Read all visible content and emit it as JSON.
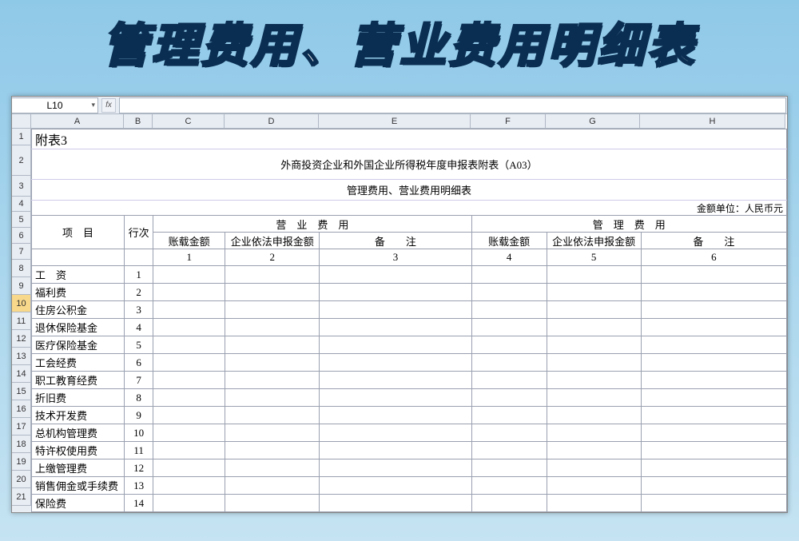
{
  "banner": {
    "text": "管理费用、营业费用明细表"
  },
  "formula_bar": {
    "cell_ref": "L10",
    "fx_label": "fx"
  },
  "columns": [
    "A",
    "B",
    "C",
    "D",
    "E",
    "F",
    "G",
    "H"
  ],
  "row_numbers": [
    1,
    2,
    3,
    4,
    5,
    6,
    7,
    8,
    9,
    10,
    11,
    12,
    13,
    14,
    15,
    16,
    17,
    18,
    19,
    20,
    21
  ],
  "selected_row": 10,
  "sheet": {
    "attachment_label": "附表3",
    "title1": "外商投资企业和外国企业所得税年度申报表附表（A03）",
    "title2": "管理费用、营业费用明细表",
    "unit_label": "金额单位：人民币元",
    "header": {
      "item": "项　目",
      "row_no": "行次",
      "group1": "营　业　费　用",
      "group2": "管　理　费　用",
      "col1": "账载金额",
      "col2": "企业依法申报金额",
      "col3": "备　　注",
      "col4": "账载金额",
      "col5": "企业依法申报金额",
      "col6": "备　　注",
      "num1": "1",
      "num2": "2",
      "num3": "3",
      "num4": "4",
      "num5": "5",
      "num6": "6"
    },
    "rows": [
      {
        "label": "工　资",
        "n": "1"
      },
      {
        "label": "福利费",
        "n": "2"
      },
      {
        "label": "住房公积金",
        "n": "3"
      },
      {
        "label": "退休保险基金",
        "n": "4"
      },
      {
        "label": "医疗保险基金",
        "n": "5"
      },
      {
        "label": "工会经费",
        "n": "6"
      },
      {
        "label": "职工教育经费",
        "n": "7"
      },
      {
        "label": "折旧费",
        "n": "8"
      },
      {
        "label": "技术开发费",
        "n": "9"
      },
      {
        "label": "总机构管理费",
        "n": "10"
      },
      {
        "label": "特许权使用费",
        "n": "11"
      },
      {
        "label": "上缴管理费",
        "n": "12"
      },
      {
        "label": "销售佣金或手续费",
        "n": "13"
      },
      {
        "label": "保险费",
        "n": "14"
      }
    ]
  },
  "chart_data": {
    "type": "table",
    "title": "管理费用、营业费用明细表",
    "columns": [
      "项目",
      "行次",
      "营业费用-账载金额",
      "营业费用-企业依法申报金额",
      "营业费用-备注",
      "管理费用-账载金额",
      "管理费用-企业依法申报金额",
      "管理费用-备注"
    ],
    "rows": [
      [
        "工资",
        1,
        null,
        null,
        null,
        null,
        null,
        null
      ],
      [
        "福利费",
        2,
        null,
        null,
        null,
        null,
        null,
        null
      ],
      [
        "住房公积金",
        3,
        null,
        null,
        null,
        null,
        null,
        null
      ],
      [
        "退休保险基金",
        4,
        null,
        null,
        null,
        null,
        null,
        null
      ],
      [
        "医疗保险基金",
        5,
        null,
        null,
        null,
        null,
        null,
        null
      ],
      [
        "工会经费",
        6,
        null,
        null,
        null,
        null,
        null,
        null
      ],
      [
        "职工教育经费",
        7,
        null,
        null,
        null,
        null,
        null,
        null
      ],
      [
        "折旧费",
        8,
        null,
        null,
        null,
        null,
        null,
        null
      ],
      [
        "技术开发费",
        9,
        null,
        null,
        null,
        null,
        null,
        null
      ],
      [
        "总机构管理费",
        10,
        null,
        null,
        null,
        null,
        null,
        null
      ],
      [
        "特许权使用费",
        11,
        null,
        null,
        null,
        null,
        null,
        null
      ],
      [
        "上缴管理费",
        12,
        null,
        null,
        null,
        null,
        null,
        null
      ],
      [
        "销售佣金或手续费",
        13,
        null,
        null,
        null,
        null,
        null,
        null
      ],
      [
        "保险费",
        14,
        null,
        null,
        null,
        null,
        null,
        null
      ]
    ]
  }
}
